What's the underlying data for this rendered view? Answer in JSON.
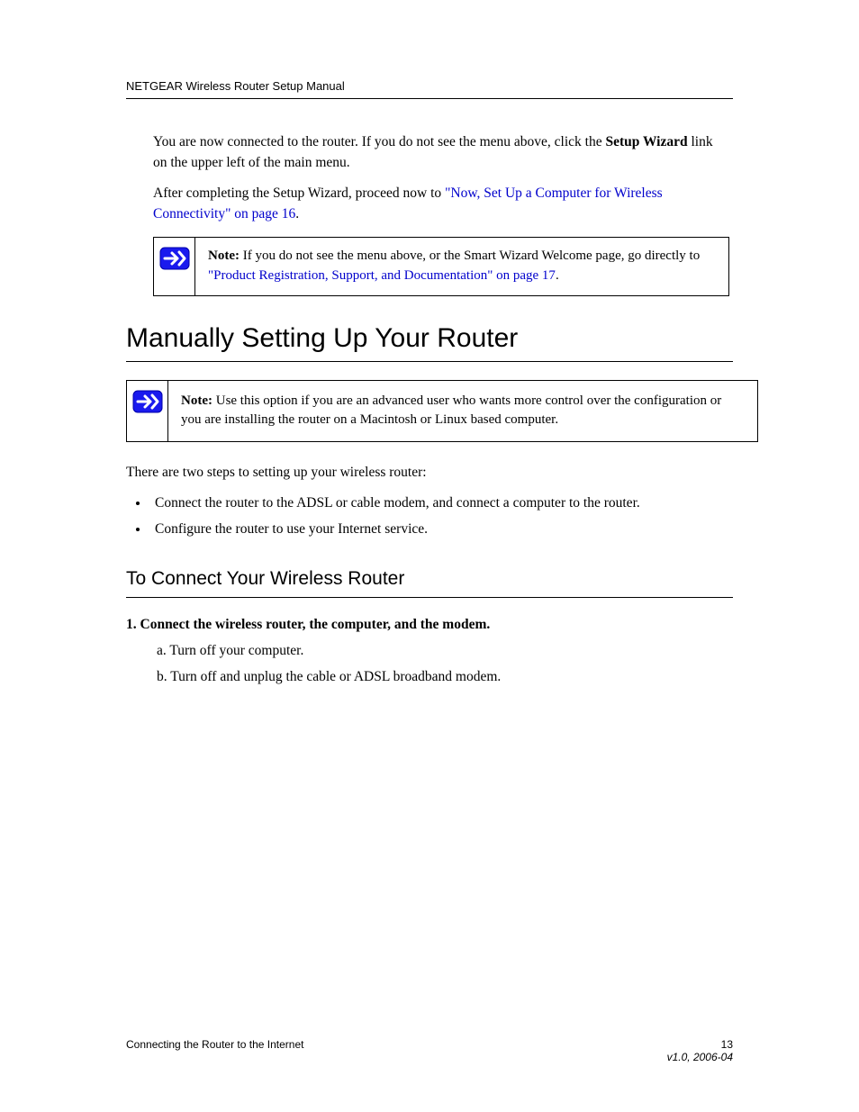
{
  "header": {
    "left": "NETGEAR Wireless Router Setup Manual",
    "right": ""
  },
  "intro": {
    "line1_prefix": "You are now connected to the router. If you do not see the menu above, click the ",
    "line1_bold": "Setup Wizard",
    "line1_suffix": " link on the upper left of the main menu.",
    "line2_prefix": "After completing the Setup Wizard, proceed now to ",
    "line2_link": "\"Now, Set Up a Computer for Wireless Connectivity\" on page 16",
    "line2_suffix": "."
  },
  "note1": {
    "label": "Note:",
    "text": " If you do not see the menu above, or the Smart Wizard Welcome page, go directly to ",
    "link": "\"Product Registration, Support, and Documentation\" on page 17",
    "suffix": "."
  },
  "section": {
    "heading": "Manually Setting Up Your Router"
  },
  "note2": {
    "label": "Note:",
    "text": " Use this option if you are an advanced user who wants more control over the configuration or you are installing the router on a Macintosh or Linux based computer."
  },
  "body": {
    "p1": "There are two steps to setting up your wireless router:",
    "bullets": [
      "Connect the router to the ADSL or cable modem, and connect a computer to the router.",
      "Configure the router to use your Internet service."
    ]
  },
  "subsection": {
    "heading": "To Connect Your Wireless Router",
    "p1_a": "1. Connect the wireless router, the computer, and the modem.",
    "p1_b": "a. Turn off your computer.",
    "p1_c": "b. Turn off and unplug the cable or ADSL broadband modem."
  },
  "footer": {
    "left": "Connecting the Router to the Internet",
    "right_top": "13",
    "right_bottom": "v1.0, 2006-04"
  }
}
